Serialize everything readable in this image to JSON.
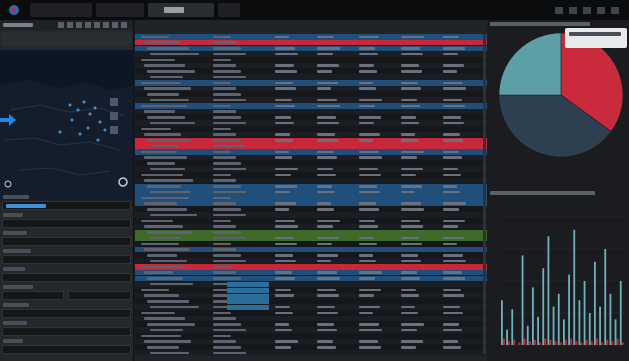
{
  "colors": {
    "accent_red": "#c8283a",
    "accent_blue": "#1f4f7a",
    "accent_green": "#3f6b2a",
    "pie_red": "#c92a3c",
    "pie_teal": "#5e9ea6",
    "pie_slate": "#2e4050",
    "bar_teal": "#6fb0bc",
    "bar_red": "#c8283a",
    "arrow_blue": "#1e88e5"
  },
  "icons": [
    "app-logo-icon",
    "map-pin-icon",
    "arrow-right-icon",
    "toolbar-icons",
    "window-control-icons",
    "toggle-icon"
  ],
  "chart_data": [
    {
      "type": "pie",
      "title": "",
      "categories": [
        "",
        "",
        ""
      ],
      "values": [
        0.35,
        0.4,
        0.25
      ],
      "colors": [
        "#c92a3c",
        "#2e4050",
        "#5e9ea6"
      ]
    },
    {
      "type": "bar",
      "title": "",
      "categories": [],
      "series": [
        {
          "values": [
            0.35,
            0.12,
            0.28,
            0.0,
            0.7,
            0.15,
            0.45,
            0.22,
            0.6,
            0.85,
            0.3,
            0.4,
            0.2,
            0.55,
            0.9,
            0.35,
            0.5,
            0.25,
            0.65,
            0.3,
            0.75,
            0.4,
            0.2,
            0.5
          ]
        },
        {
          "values": [
            0.05,
            0.03,
            0.04,
            0.02,
            0.05,
            0.03,
            0.04,
            0.02,
            0.05,
            0.04,
            0.03,
            0.02,
            0.04,
            0.05,
            0.03,
            0.02,
            0.04,
            0.03,
            0.05,
            0.02,
            0.04,
            0.03,
            0.05,
            0.02
          ]
        }
      ]
    }
  ]
}
